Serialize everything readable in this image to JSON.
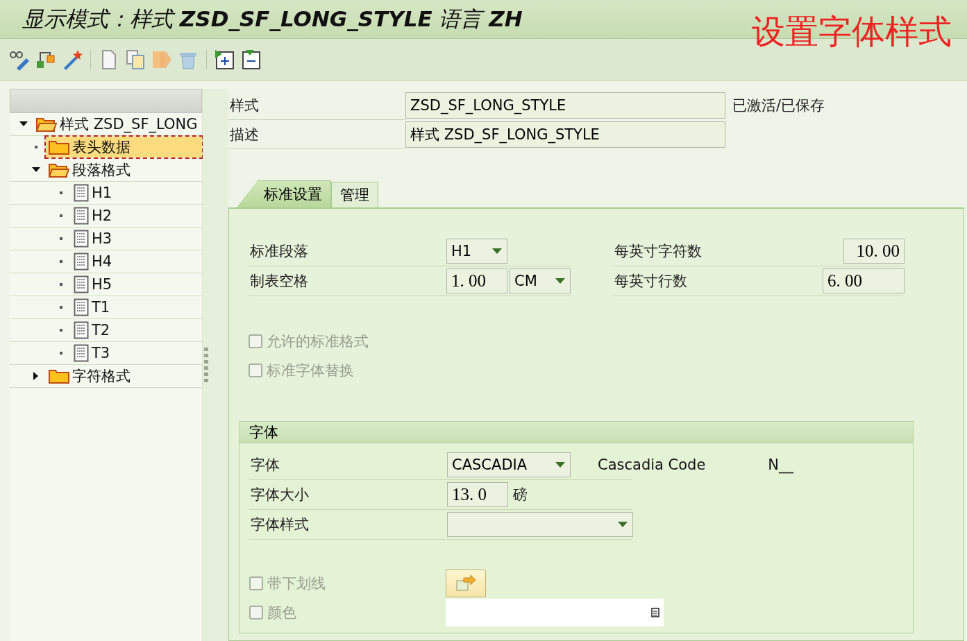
{
  "window": {
    "title": "显示模式：样式 **ZSD_SF_LONG_STYLE** 语言 **ZH**"
  },
  "annotation": "设置字体样式",
  "tree": [
    {
      "label": "样式 ZSD_SF_LONG",
      "kind": "folder",
      "expanded": true,
      "selected": false,
      "children": [
        {
          "label": "表头数据",
          "kind": "folder",
          "expanded": false,
          "selected": true
        },
        {
          "label": "段落格式",
          "kind": "folder",
          "expanded": true,
          "selected": false,
          "children": [
            {
              "label": "H1",
              "kind": "doc",
              "selected": false
            },
            {
              "label": "H2",
              "kind": "doc",
              "selected": false
            },
            {
              "label": "H3",
              "kind": "doc",
              "selected": false
            },
            {
              "label": "H4",
              "kind": "doc",
              "selected": false
            },
            {
              "label": "H5",
              "kind": "doc",
              "selected": false
            },
            {
              "label": "T1",
              "kind": "doc",
              "selected": false
            },
            {
              "label": "T2",
              "kind": "doc",
              "selected": false
            },
            {
              "label": "T3",
              "kind": "doc",
              "selected": false
            }
          ]
        },
        {
          "label": "字符格式",
          "kind": "folder",
          "expanded": false,
          "selected": false,
          "has_children": true
        }
      ]
    }
  ],
  "header": {
    "fields": [
      {
        "label": "样式",
        "value": "ZSD_SF_LONG_STYLE"
      },
      {
        "label": "描述",
        "value": "样式 ZSD_SF_LONG_STYLE"
      }
    ],
    "status": "已激活/已保存"
  },
  "tabs": [
    {
      "label": "标准设置",
      "selected": true
    },
    {
      "label": "管理",
      "selected": false
    }
  ],
  "settings": {
    "left": [
      {
        "label": "标准段落",
        "kind": "dropdown",
        "value": "H1"
      },
      {
        "label": "制表空格",
        "kind": "number_unit",
        "value": "1. 00",
        "unit": "CM"
      }
    ],
    "right": [
      {
        "label": "每英寸字符数",
        "value": "10. 00"
      },
      {
        "label": "每英寸行数",
        "value": "6. 00"
      }
    ],
    "checkboxes": [
      {
        "label": "允许的标准格式",
        "checked": false,
        "disabled": true
      },
      {
        "label": "标准字体替换",
        "checked": false,
        "disabled": true
      }
    ]
  },
  "font_group": {
    "title": "字体",
    "rows": [
      {
        "label": "字体",
        "kind": "dropdown",
        "value": "CASCADIA",
        "extra": "Cascadia Code",
        "extra2": "N__"
      },
      {
        "label": "字体大小",
        "kind": "number",
        "value": "13. 0",
        "unit": "磅"
      },
      {
        "label": "字体样式",
        "kind": "dropdown_wide"
      }
    ],
    "checkboxes": [
      {
        "label": "带下划线",
        "checked": false,
        "disabled": true,
        "kind": "button"
      },
      {
        "label": "颜色",
        "checked": false,
        "disabled": true,
        "kind": "color_field"
      }
    ]
  }
}
